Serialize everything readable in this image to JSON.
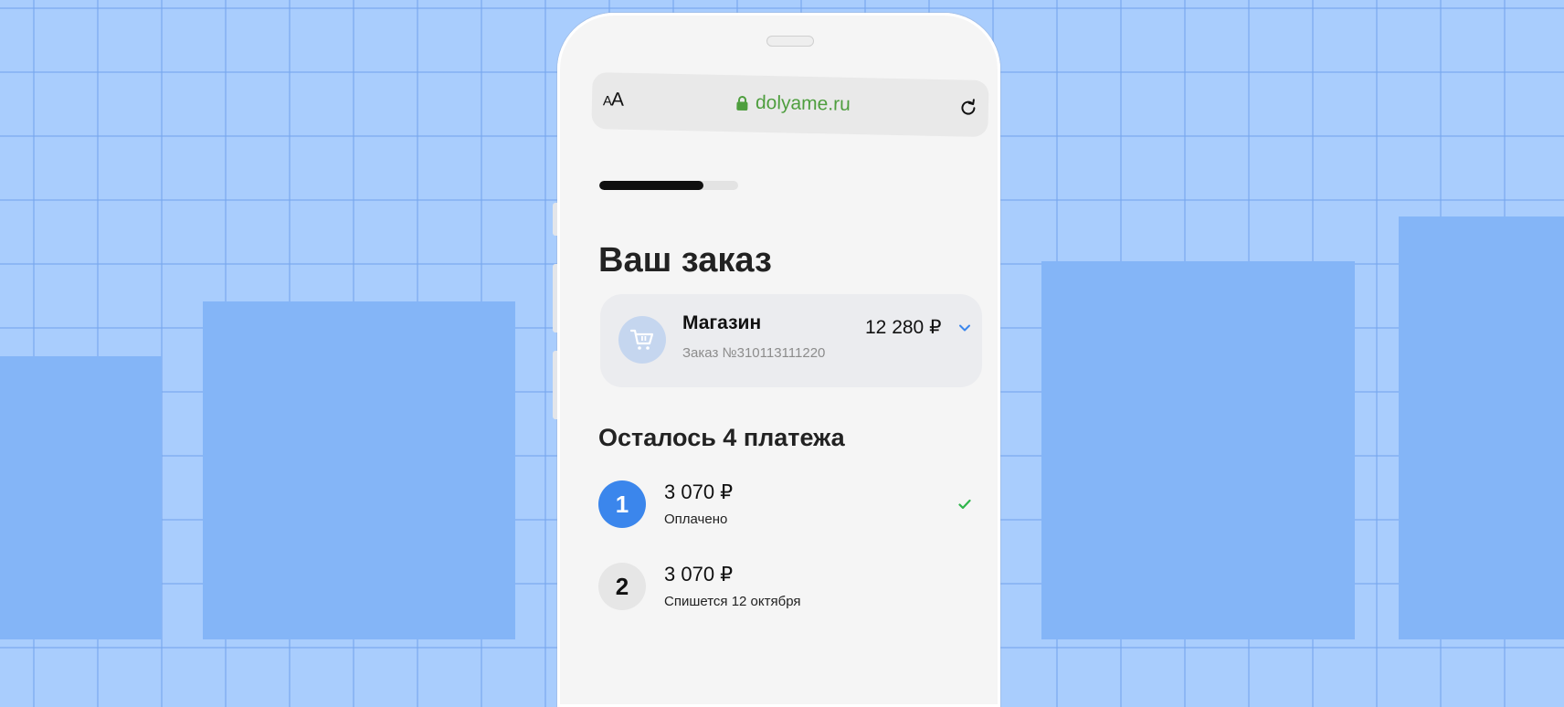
{
  "browser": {
    "text_size_label": "AA",
    "url": "dolyame.ru",
    "icons": {
      "lock": "lock-icon",
      "reload": "reload-icon"
    }
  },
  "checkout": {
    "progress": 0.75,
    "title": "Ваш заказ",
    "order": {
      "shop_name": "Магазин",
      "order_number": "Заказ №310113111220",
      "amount": "12 280 ₽"
    },
    "payments_title": "Осталось 4 платежа",
    "payments": [
      {
        "number": "1",
        "amount": "3 070 ₽",
        "status": "Оплачено",
        "paid": true
      },
      {
        "number": "2",
        "amount": "3 070 ₽",
        "status": "Спишется 12 октября",
        "paid": false
      }
    ]
  },
  "colors": {
    "background": "#a9cdfd",
    "bars": "#84b5f7",
    "accent_blue": "#3b86ec",
    "url_green": "#4e9e3e",
    "check_green": "#2fb54b"
  }
}
